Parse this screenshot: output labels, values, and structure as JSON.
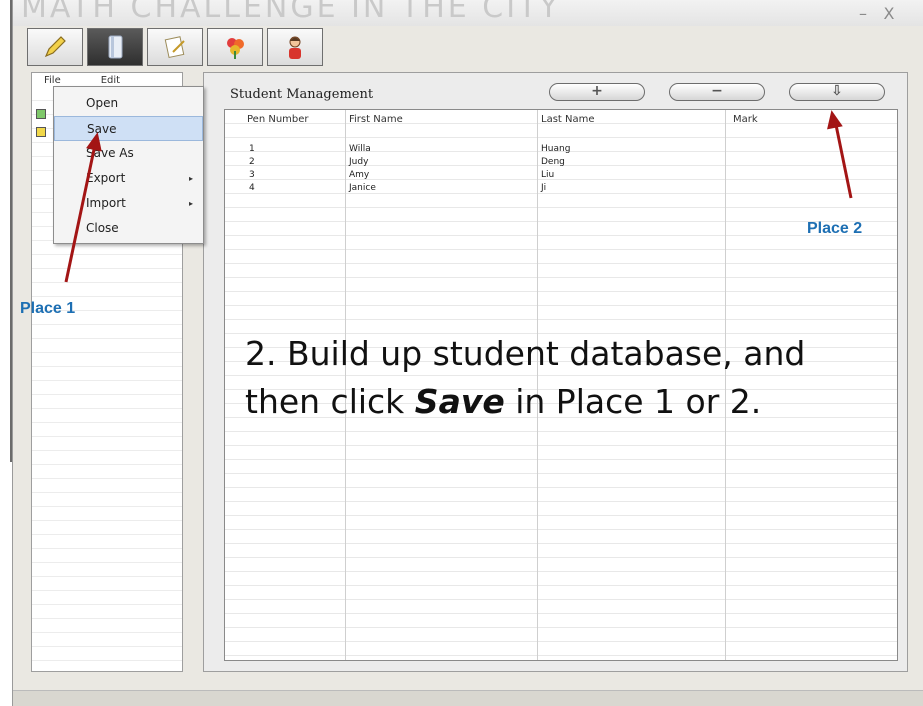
{
  "window": {
    "title": "MATH CHALLENGE IN THE CITY",
    "controls": {
      "minimize": "–",
      "close": "X"
    }
  },
  "toolbar": {
    "buttons": [
      {
        "icon": "pencil-icon"
      },
      {
        "icon": "book-icon"
      },
      {
        "icon": "note-icon"
      },
      {
        "icon": "flower-icon"
      },
      {
        "icon": "person-icon"
      }
    ]
  },
  "left_panel": {
    "file_header": "File",
    "edit_header": "Edit"
  },
  "menu": {
    "items": [
      {
        "label": "Open"
      },
      {
        "label": "Save"
      },
      {
        "label": "Save As"
      },
      {
        "label": "Export",
        "submenu": "▸"
      },
      {
        "label": "Import",
        "submenu": "▸"
      },
      {
        "label": "Close"
      }
    ]
  },
  "main_panel": {
    "title": "Student Management",
    "buttons": {
      "add": "+",
      "remove": "−",
      "save": "⇩"
    },
    "table": {
      "columns": [
        "Pen Number",
        "First Name",
        "Last Name",
        "Mark"
      ],
      "rows": [
        [
          "1",
          "Willa",
          "Huang",
          ""
        ],
        [
          "2",
          "Judy",
          "Deng",
          ""
        ],
        [
          "3",
          "Amy",
          "Liu",
          ""
        ],
        [
          "4",
          "Janice",
          "Ji",
          ""
        ]
      ]
    }
  },
  "annotations": {
    "place1": "Place 1",
    "place2": "Place 2",
    "instruction_prefix": "2. Build up student database, and then click ",
    "instruction_emphasis": "Save",
    "instruction_suffix": " in Place 1 or 2.",
    "arrow_color": "#a31515",
    "label_color": "#1d6fb3"
  }
}
